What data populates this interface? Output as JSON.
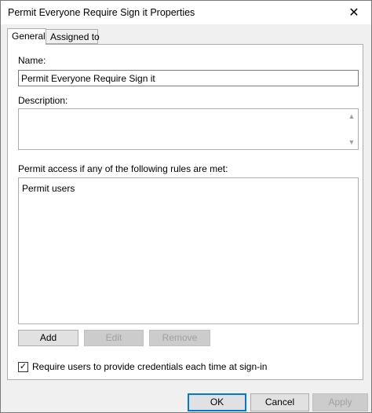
{
  "window": {
    "title": "Permit Everyone Require Sign it Properties",
    "close_glyph": "✕"
  },
  "tabs": [
    {
      "label": "General",
      "active": true
    },
    {
      "label": "Assigned to",
      "active": false
    }
  ],
  "general": {
    "name_label": "Name:",
    "name_value": "Permit Everyone Require Sign it",
    "description_label": "Description:",
    "description_value": "",
    "rules_label": "Permit access if any of the following rules are met:",
    "rules": [
      "Permit users"
    ],
    "add_label": "Add",
    "edit_label": "Edit",
    "remove_label": "Remove",
    "require_credentials_label": "Require users to provide credentials each time at sign-in",
    "require_credentials_checked": true
  },
  "footer": {
    "ok_label": "OK",
    "cancel_label": "Cancel",
    "apply_label": "Apply"
  },
  "icons": {
    "scroll_up": "▲",
    "scroll_down": "▼",
    "check": "✓"
  },
  "colors": {
    "focus_border": "#0078d7",
    "disabled_text": "#a0a0a0"
  }
}
